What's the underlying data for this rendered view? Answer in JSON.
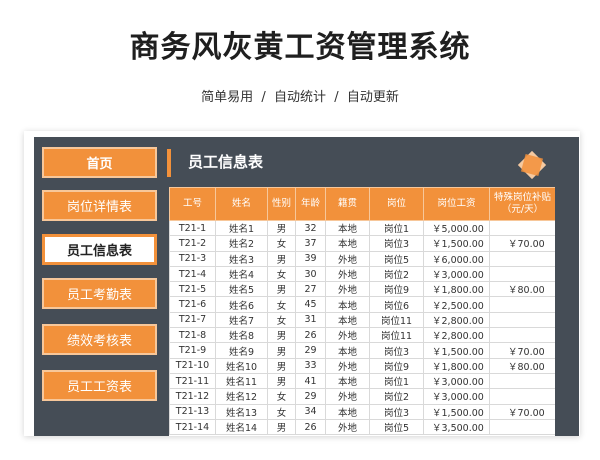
{
  "title": "商务风灰黄工资管理系统",
  "subtitle": "简单易用  /  自动统计  /  自动更新",
  "nav": [
    {
      "label": "首页"
    },
    {
      "label": "岗位详情表"
    },
    {
      "label": "员工信息表"
    },
    {
      "label": "员工考勤表"
    },
    {
      "label": "绩效考核表"
    },
    {
      "label": "员工工资表"
    }
  ],
  "section_title": "员工信息表",
  "table": {
    "headers": [
      "工号",
      "姓名",
      "性别",
      "年龄",
      "籍贯",
      "岗位",
      "岗位工资",
      "特殊岗位补贴\n（元/天）"
    ],
    "rows": [
      [
        "T21-1",
        "姓名1",
        "男",
        "32",
        "本地",
        "岗位1",
        "￥5,000.00",
        ""
      ],
      [
        "T21-2",
        "姓名2",
        "女",
        "37",
        "本地",
        "岗位3",
        "￥1,500.00",
        "￥70.00"
      ],
      [
        "T21-3",
        "姓名3",
        "男",
        "39",
        "外地",
        "岗位5",
        "￥6,000.00",
        ""
      ],
      [
        "T21-4",
        "姓名4",
        "女",
        "30",
        "外地",
        "岗位2",
        "￥3,000.00",
        ""
      ],
      [
        "T21-5",
        "姓名5",
        "男",
        "27",
        "外地",
        "岗位9",
        "￥1,800.00",
        "￥80.00"
      ],
      [
        "T21-6",
        "姓名6",
        "女",
        "45",
        "本地",
        "岗位6",
        "￥2,500.00",
        ""
      ],
      [
        "T21-7",
        "姓名7",
        "女",
        "31",
        "本地",
        "岗位11",
        "￥2,800.00",
        ""
      ],
      [
        "T21-8",
        "姓名8",
        "男",
        "26",
        "外地",
        "岗位11",
        "￥2,800.00",
        ""
      ],
      [
        "T21-9",
        "姓名9",
        "男",
        "29",
        "本地",
        "岗位3",
        "￥1,500.00",
        "￥70.00"
      ],
      [
        "T21-10",
        "姓名10",
        "男",
        "33",
        "外地",
        "岗位9",
        "￥1,800.00",
        "￥80.00"
      ],
      [
        "T21-11",
        "姓名11",
        "男",
        "41",
        "本地",
        "岗位1",
        "￥3,000.00",
        ""
      ],
      [
        "T21-12",
        "姓名12",
        "女",
        "29",
        "外地",
        "岗位2",
        "￥3,000.00",
        ""
      ],
      [
        "T21-13",
        "姓名13",
        "女",
        "34",
        "本地",
        "岗位3",
        "￥1,500.00",
        "￥70.00"
      ],
      [
        "T21-14",
        "姓名14",
        "男",
        "26",
        "外地",
        "岗位5",
        "￥3,500.00",
        ""
      ]
    ]
  },
  "colors": {
    "accent": "#f2913b",
    "panel": "#454d56",
    "icon_light": "#f5c9a0"
  },
  "icons": {
    "logo": "diamond-star-icon"
  }
}
